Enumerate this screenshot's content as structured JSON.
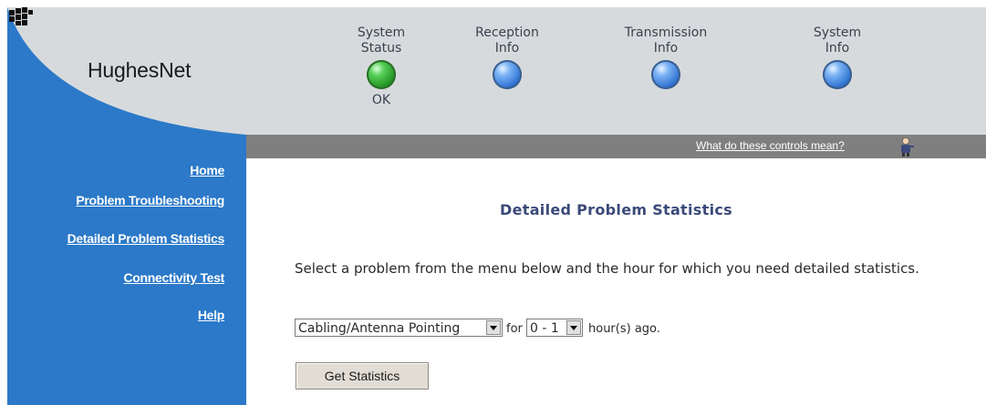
{
  "brand": {
    "name": "HughesNet",
    "trademark": "."
  },
  "status_indicators": [
    {
      "label_line1": "System",
      "label_line2": "Status",
      "state": "ok",
      "state_text": "OK",
      "color": "#2aa52a"
    },
    {
      "label_line1": "Reception",
      "label_line2": "Info",
      "state": "info",
      "color": "#3b82e0"
    },
    {
      "label_line1": "Transmission",
      "label_line2": "Info",
      "state": "info",
      "color": "#3b82e0"
    },
    {
      "label_line1": "System",
      "label_line2": "Info",
      "state": "info",
      "color": "#3b82e0"
    }
  ],
  "toolbar": {
    "help_link": "What do these controls mean?",
    "helper_icon": "person-helper-icon"
  },
  "sidebar": {
    "items": [
      {
        "label": "Home"
      },
      {
        "label": "Problem Troubleshooting"
      },
      {
        "label": "Detailed Problem Statistics"
      },
      {
        "label": "Connectivity Test"
      },
      {
        "label": "Help"
      }
    ]
  },
  "main": {
    "title": "Detailed Problem Statistics",
    "instructions": "Select a problem from the menu below and the hour for which you need detailed statistics.",
    "problem_select": {
      "value": "Cabling/Antenna Pointing"
    },
    "for_text": "for",
    "hour_select": {
      "value": "0 - 1"
    },
    "suffix_text": "hour(s) ago.",
    "submit_label": "Get Statistics"
  },
  "colors": {
    "sidebar": "#2b79c8",
    "header": "#d7dadc",
    "toolbar": "#7f7f7f",
    "title": "#3b4a7a"
  }
}
